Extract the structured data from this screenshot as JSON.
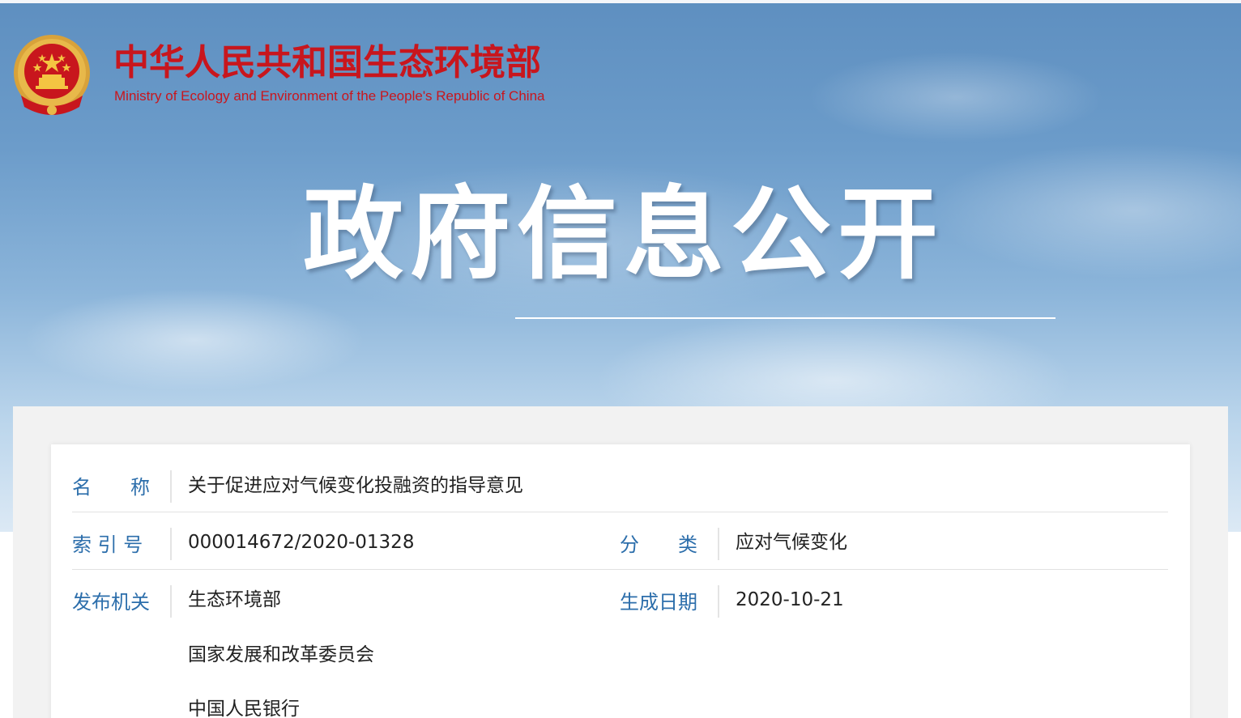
{
  "header": {
    "ministry_cn": "中华人民共和国生态环境部",
    "ministry_en": "Ministry of Ecology and Environment of the People's Republic of China",
    "banner_title": "政府信息公开",
    "emblem_icon": "national-emblem-icon"
  },
  "colors": {
    "ministry_red": "#c8161d",
    "label_blue": "#2c6eab",
    "text": "#222222",
    "sky": "#6c9cca"
  },
  "info": {
    "name_label": "名　　称",
    "name_value": "关于促进应对气候变化投融资的指导意见",
    "index_label": "索 引 号",
    "index_value": "000014672/2020-01328",
    "category_label": "分　　类",
    "category_value": "应对气候变化",
    "issuer_label": "发布机关",
    "issuers": [
      "生态环境部",
      "国家发展和改革委员会",
      "中国人民银行"
    ],
    "date_label": "生成日期",
    "date_value": "2020-10-21"
  }
}
